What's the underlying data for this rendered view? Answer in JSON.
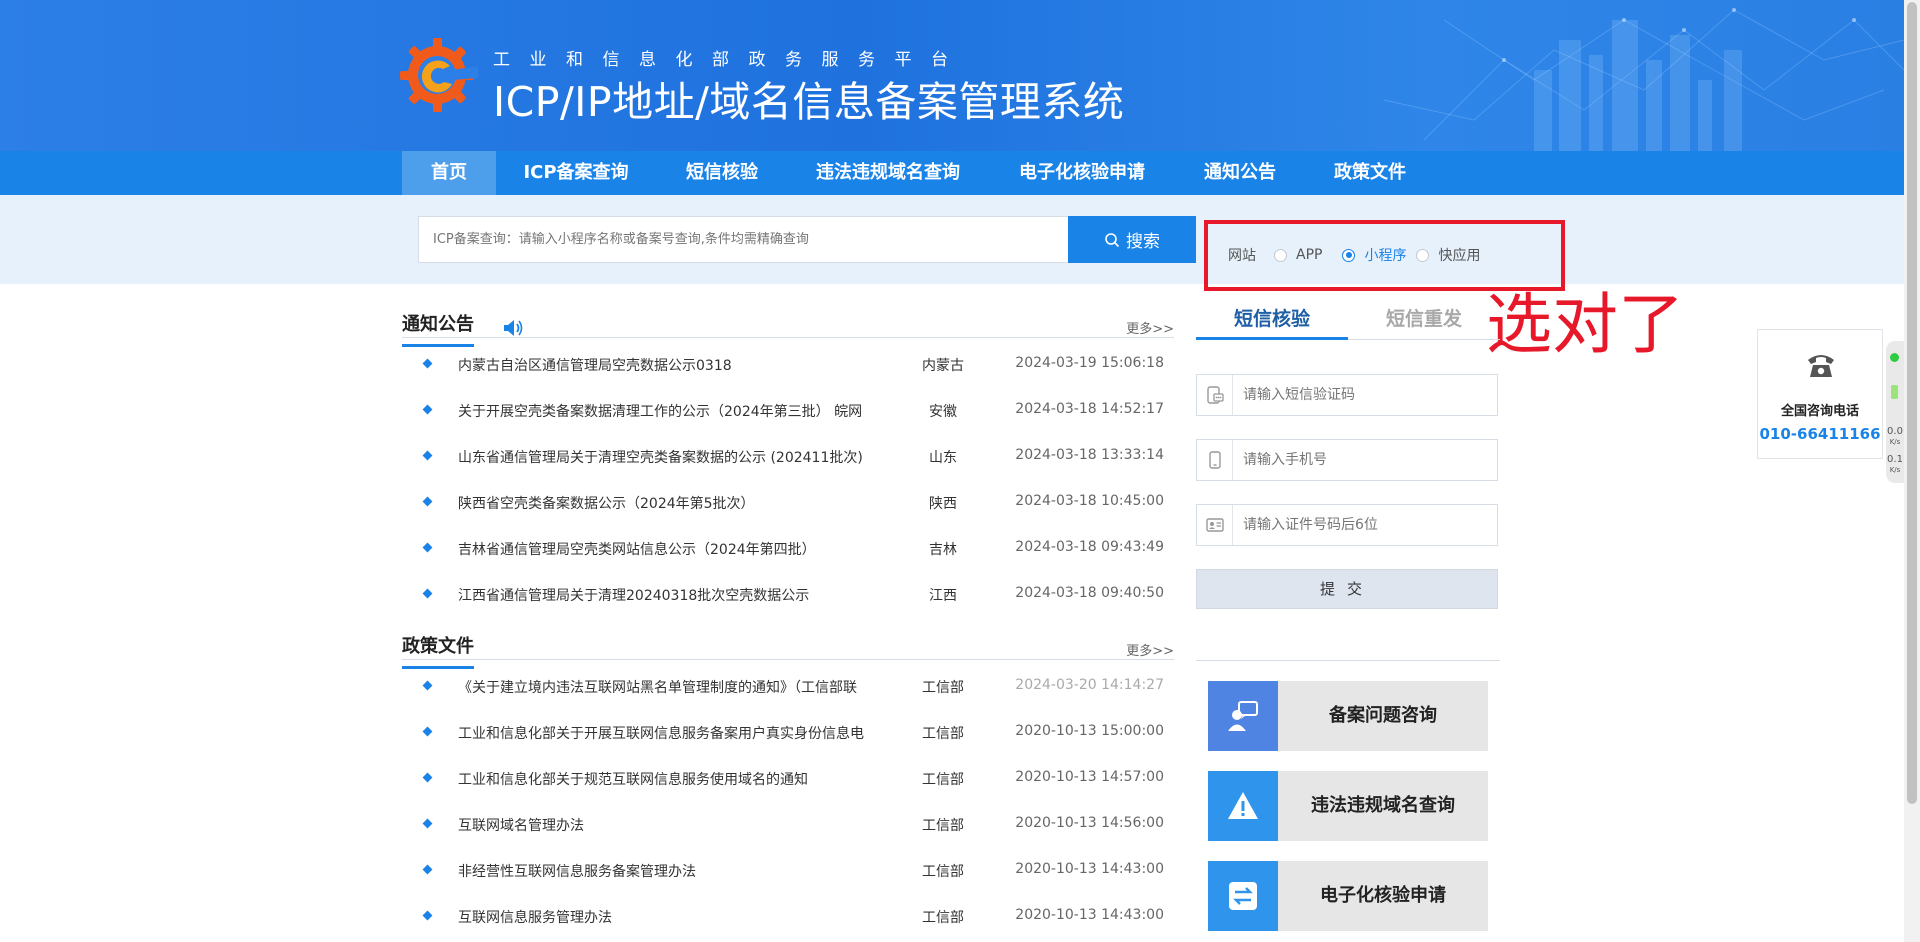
{
  "header": {
    "subtitle": "工业和信息化部政务服务平台",
    "title": "ICP/IP地址/域名信息备案管理系统"
  },
  "nav": {
    "items": [
      {
        "label": "首页",
        "active": true
      },
      {
        "label": "ICP备案查询"
      },
      {
        "label": "短信核验"
      },
      {
        "label": "违法违规域名查询"
      },
      {
        "label": "电子化核验申请"
      },
      {
        "label": "通知公告"
      },
      {
        "label": "政策文件"
      }
    ]
  },
  "search": {
    "placeholder": "ICP备案查询：请输入小程序名称或备案号查询,条件均需精确查询",
    "button_label": "搜索",
    "types": [
      {
        "label": "网站",
        "checked": false
      },
      {
        "label": "APP",
        "checked": false
      },
      {
        "label": "小程序",
        "checked": true
      },
      {
        "label": "快应用",
        "checked": false
      }
    ]
  },
  "annotation": {
    "text": "选对了",
    "color": "#e8182b"
  },
  "notices": {
    "title": "通知公告",
    "more": "更多>>",
    "items": [
      {
        "text": "内蒙古自治区通信管理局空壳数据公示0318",
        "region": "内蒙古",
        "date": "2024-03-19 15:06:18"
      },
      {
        "text": "关于开展空壳类备案数据清理工作的公示（2024年第三批） 皖网",
        "region": "安徽",
        "date": "2024-03-18 14:52:17"
      },
      {
        "text": "山东省通信管理局关于清理空壳类备案数据的公示 (202411批次)",
        "region": "山东",
        "date": "2024-03-18 13:33:14"
      },
      {
        "text": "陕西省空壳类备案数据公示（2024年第5批次）",
        "region": "陕西",
        "date": "2024-03-18 10:45:00"
      },
      {
        "text": "吉林省通信管理局空壳类网站信息公示（2024年第四批）",
        "region": "吉林",
        "date": "2024-03-18 09:43:49"
      },
      {
        "text": "江西省通信管理局关于清理20240318批次空壳数据公示",
        "region": "江西",
        "date": "2024-03-18 09:40:50"
      }
    ]
  },
  "policies": {
    "title": "政策文件",
    "more": "更多>>",
    "items": [
      {
        "text": "《关于建立境内违法互联网站黑名单管理制度的通知》（工信部联",
        "region": "工信部",
        "date": "2024-03-20 14:14:27"
      },
      {
        "text": "工业和信息化部关于开展互联网信息服务备案用户真实身份信息电",
        "region": "工信部",
        "date": "2020-10-13 15:00:00"
      },
      {
        "text": "工业和信息化部关于规范互联网信息服务使用域名的通知",
        "region": "工信部",
        "date": "2020-10-13 14:57:00"
      },
      {
        "text": "互联网域名管理办法",
        "region": "工信部",
        "date": "2020-10-13 14:56:00"
      },
      {
        "text": "非经营性互联网信息服务备案管理办法",
        "region": "工信部",
        "date": "2020-10-13 14:43:00"
      },
      {
        "text": "互联网信息服务管理办法",
        "region": "工信部",
        "date": "2020-10-13 14:43:00"
      }
    ]
  },
  "sms": {
    "tabs": [
      "短信核验",
      "短信重发"
    ],
    "code_placeholder": "请输入短信验证码",
    "phone_placeholder": "请输入手机号",
    "id_placeholder": "请输入证件号码后6位",
    "submit_label": "提交"
  },
  "quick_links": [
    {
      "label": "备案问题咨询",
      "color": "#4f84e2",
      "icon": "consult-icon"
    },
    {
      "label": "违法违规域名查询",
      "color": "#2f95ec",
      "icon": "warning-icon"
    },
    {
      "label": "电子化核验申请",
      "color": "#2f95ec",
      "icon": "exchange-icon"
    }
  ],
  "hotline": {
    "label": "全国咨询电话",
    "number": "010-66411166"
  },
  "net_widget": {
    "up": "0.0",
    "down": "0.1",
    "unit": "K/s"
  }
}
